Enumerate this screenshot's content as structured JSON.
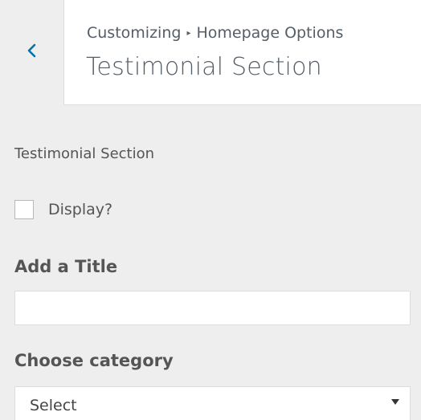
{
  "header": {
    "breadcrumb_parent": "Customizing",
    "breadcrumb_separator": "▸",
    "breadcrumb_current": "Homepage Options",
    "title": "Testimonial Section",
    "back_icon": "chevron-left-icon",
    "accent_color": "#0073aa"
  },
  "section": {
    "heading": "Testimonial Section",
    "display_checkbox": {
      "label": "Display?",
      "checked": false
    },
    "title_field": {
      "label": "Add a Title",
      "value": ""
    },
    "category_field": {
      "label": "Choose category",
      "selected": "Select",
      "arrow_icon": "caret-down-icon"
    }
  }
}
